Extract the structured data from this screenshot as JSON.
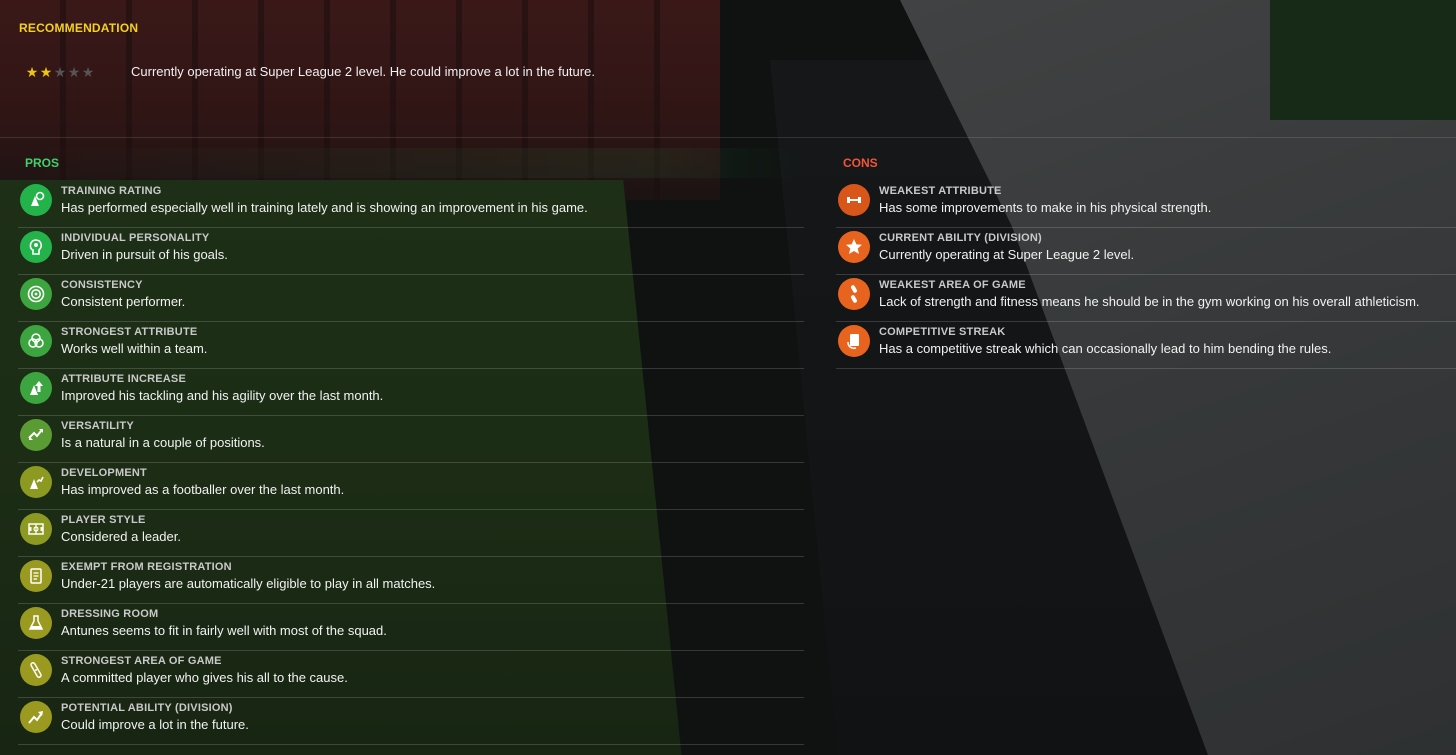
{
  "recommendation": {
    "title": "RECOMMENDATION",
    "stars_filled": 2,
    "stars_total": 5,
    "text": "Currently operating at Super League 2 level. He could improve a lot in the future."
  },
  "pros": {
    "heading": "PROS",
    "items": [
      {
        "title": "TRAINING RATING",
        "desc": "Has performed especially well in training lately and is showing an improvement in his game.",
        "icon": "training-icon"
      },
      {
        "title": "INDIVIDUAL PERSONALITY",
        "desc": "Driven in pursuit of his goals.",
        "icon": "head-icon"
      },
      {
        "title": "CONSISTENCY",
        "desc": "Consistent performer.",
        "icon": "target-icon"
      },
      {
        "title": "STRONGEST ATTRIBUTE",
        "desc": "Works well within a team.",
        "icon": "circles-icon"
      },
      {
        "title": "ATTRIBUTE INCREASE",
        "desc": "Improved his tackling and his agility over the last month.",
        "icon": "arrow-up-icon"
      },
      {
        "title": "VERSATILITY",
        "desc": "Is a natural in a couple of positions.",
        "icon": "swap-icon"
      },
      {
        "title": "DEVELOPMENT",
        "desc": "Has improved as a footballer over the last month.",
        "icon": "growth-icon"
      },
      {
        "title": "PLAYER STYLE",
        "desc": "Considered a leader.",
        "icon": "pitch-icon"
      },
      {
        "title": "EXEMPT FROM REGISTRATION",
        "desc": "Under-21 players are automatically eligible to play in all matches.",
        "icon": "document-icon"
      },
      {
        "title": "DRESSING ROOM",
        "desc": "Antunes seems to fit in fairly well with most of the squad.",
        "icon": "flask-icon"
      },
      {
        "title": "STRONGEST AREA OF GAME",
        "desc": "A committed player who gives his all to the cause.",
        "icon": "bandage-icon"
      },
      {
        "title": "POTENTIAL ABILITY (DIVISION)",
        "desc": "Could improve a lot in the future.",
        "icon": "trend-up-icon"
      }
    ]
  },
  "cons": {
    "heading": "CONS",
    "items": [
      {
        "title": "WEAKEST ATTRIBUTE",
        "desc": "Has some improvements to make in his physical strength.",
        "icon": "dumbbell-icon"
      },
      {
        "title": "CURRENT ABILITY (DIVISION)",
        "desc": "Currently operating at Super League 2 level.",
        "icon": "star-icon"
      },
      {
        "title": "WEAKEST AREA OF GAME",
        "desc": "Lack of strength and fitness means he should be in the gym working on his overall athleticism.",
        "icon": "broken-bandage-icon"
      },
      {
        "title": "COMPETITIVE STREAK",
        "desc": "Has a competitive streak which can occasionally lead to him bending the rules.",
        "icon": "card-icon"
      }
    ]
  },
  "colors": {
    "recommendation_title": "#f3d21f",
    "pros_heading": "#3fd16b",
    "cons_heading": "#f0553a",
    "star_filled": "#f1c40f",
    "cons_icon": "#e8641e"
  }
}
